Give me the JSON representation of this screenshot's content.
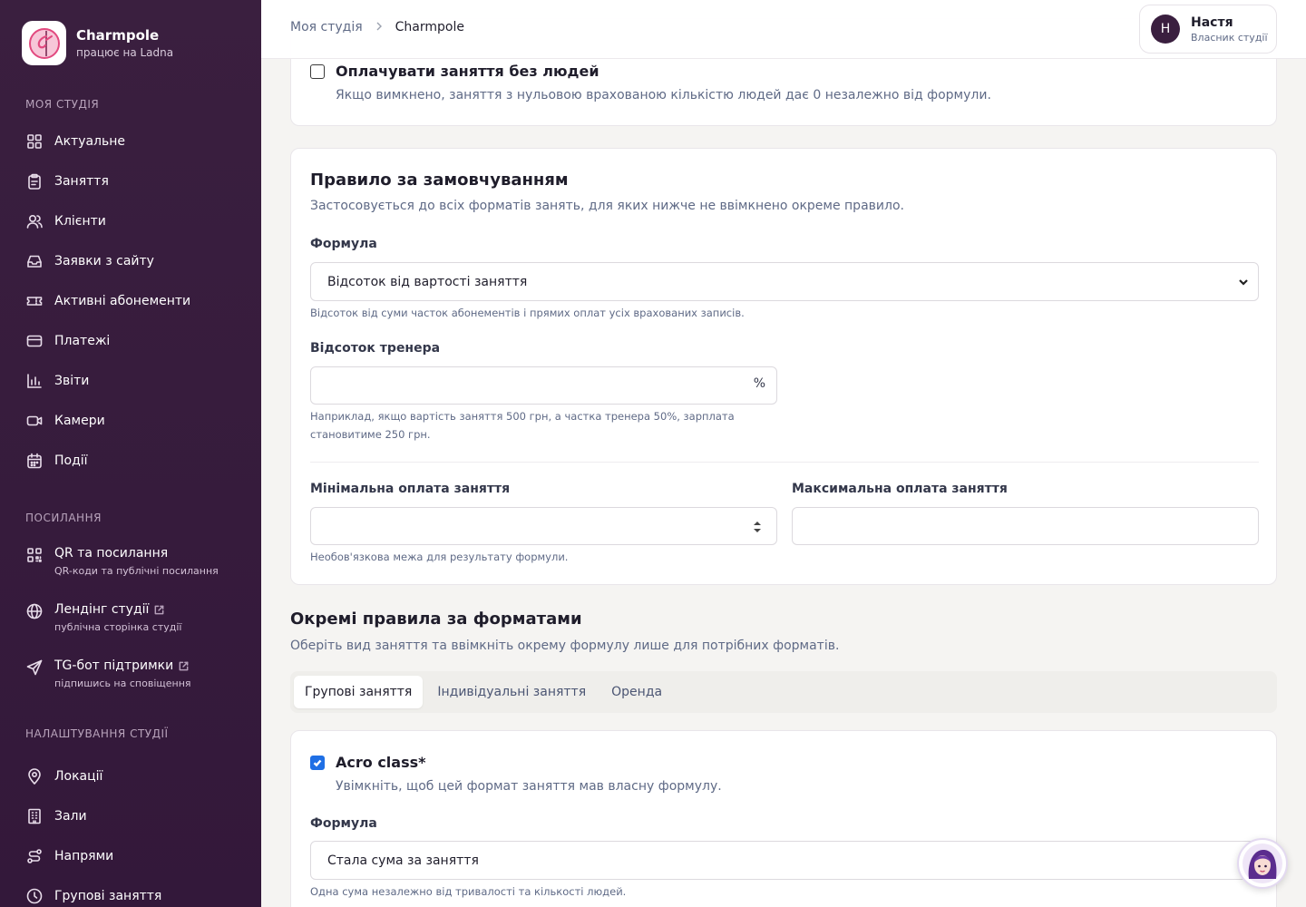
{
  "brand": {
    "name": "Charmpole",
    "sub": "працює на Ladna"
  },
  "sidebar": {
    "section_studio": "МОЯ СТУДІЯ",
    "studio_items": [
      {
        "label": "Актуальне",
        "icon": "grid-icon"
      },
      {
        "label": "Заняття",
        "icon": "clipboard-icon"
      },
      {
        "label": "Клієнти",
        "icon": "users-icon"
      },
      {
        "label": "Заявки з сайту",
        "icon": "inbox-icon"
      },
      {
        "label": "Активні абонементи",
        "icon": "ticket-icon"
      },
      {
        "label": "Платежі",
        "icon": "credit-card-icon"
      },
      {
        "label": "Звіти",
        "icon": "bar-chart-icon"
      },
      {
        "label": "Камери",
        "icon": "video-icon"
      },
      {
        "label": "Події",
        "icon": "calendar-icon"
      }
    ],
    "section_links": "ПОСИЛАННЯ",
    "link_items": [
      {
        "label": "QR та посилання",
        "sub": "QR-коди та публічні посилання",
        "icon": "qr-icon",
        "external": false
      },
      {
        "label": "Лендінг студії",
        "sub": "публічна сторінка студії",
        "icon": "globe-icon",
        "external": true
      },
      {
        "label": "TG-бот підтримки",
        "sub": "підпишись на сповіщення",
        "icon": "send-icon",
        "external": true
      }
    ],
    "section_settings": "НАЛАШТУВАННЯ СТУДІЇ",
    "settings_items": [
      {
        "label": "Локації",
        "icon": "map-pin-icon"
      },
      {
        "label": "Зали",
        "icon": "building-icon"
      },
      {
        "label": "Напрями",
        "icon": "route-icon"
      },
      {
        "label": "Групові заняття",
        "icon": "clock-icon"
      }
    ]
  },
  "header": {
    "breadcrumb_root": "Моя студія",
    "breadcrumb_current": "Charmpole",
    "user_initial": "Н",
    "user_name": "Настя",
    "user_role": "Власник студії"
  },
  "pay_empty": {
    "title": "Оплачувати заняття без людей",
    "desc": "Якщо вимкнено, заняття з нульовою врахованою кількістю людей дає 0 незалежно від формули.",
    "checked": false
  },
  "default_rule": {
    "title": "Правило за замовчуванням",
    "subtitle": "Застосовується до всіх форматів занять, для яких нижче не ввімкнено окреме правило.",
    "formula_label": "Формула",
    "formula_value": "Відсоток від вартості заняття",
    "formula_hint": "Відсоток від суми часток абонементів і прямих оплат усіх врахованих записів.",
    "percent_label": "Відсоток тренера",
    "percent_suffix": "%",
    "percent_hint": "Наприклад, якщо вартість заняття 500 грн, а частка тренера 50%, зарплата становитиме 250 грн.",
    "min_label": "Мінімальна оплата заняття",
    "min_hint": "Необов'язкова межа для результату формули.",
    "max_label": "Максимальна оплата заняття"
  },
  "format_rules": {
    "title": "Окремі правила за форматами",
    "subtitle": "Оберіть вид заняття та ввімкніть окрему формулу лише для потрібних форматів.",
    "tabs": [
      "Групові заняття",
      "Індивідуальні заняття",
      "Оренда"
    ],
    "active_tab": 0
  },
  "acro": {
    "title": "Acro class*",
    "desc": "Увімкніть, щоб цей формат заняття мав власну формулу.",
    "checked": true,
    "formula_label": "Формула",
    "formula_value": "Стала сума за заняття",
    "formula_hint": "Одна сума незалежно від тривалості та кількості людей."
  },
  "colors": {
    "sidebar": "#3a1f3f",
    "accent": "#1f6fe5",
    "muted": "#5f6a86"
  }
}
